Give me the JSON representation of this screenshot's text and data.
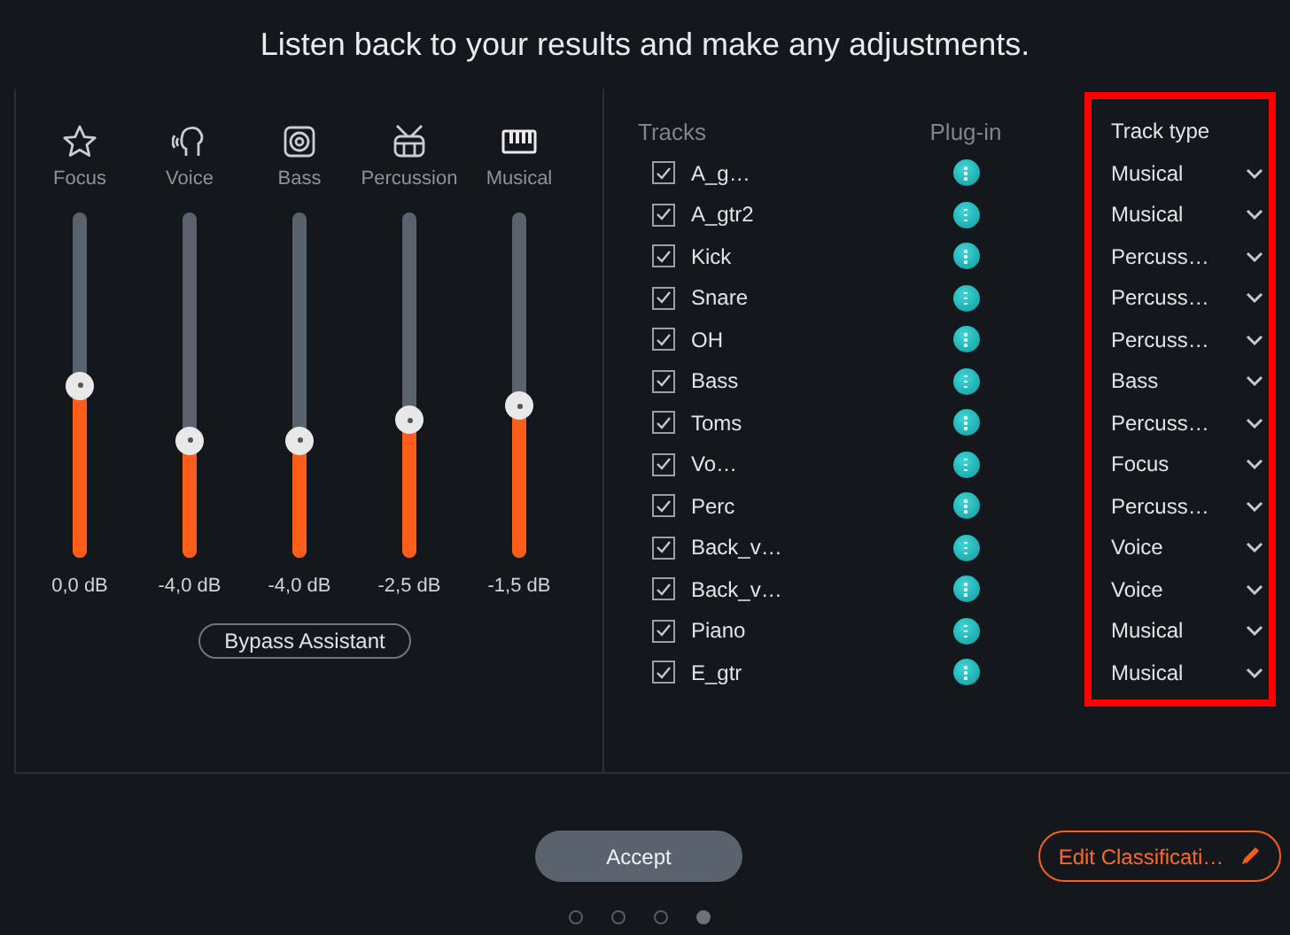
{
  "title": "Listen back to your results and make any adjustments.",
  "channels": [
    {
      "kind": "star",
      "label": "Focus",
      "level": 0.5,
      "reading": "0,0 dB"
    },
    {
      "kind": "voice",
      "label": "Voice",
      "level": 0.34,
      "reading": "-4,0 dB"
    },
    {
      "kind": "speaker",
      "label": "Bass",
      "level": 0.34,
      "reading": "-4,0 dB"
    },
    {
      "kind": "drum",
      "label": "Percussion",
      "level": 0.4,
      "reading": "-2,5 dB"
    },
    {
      "kind": "keys",
      "label": "Musical",
      "level": 0.44,
      "reading": "-1,5 dB"
    }
  ],
  "bypass_button": "Bypass Assistant",
  "table": {
    "columns": [
      "Tracks",
      "Plug-in",
      "Track type"
    ],
    "track_type_highlighted": true,
    "rows": [
      {
        "checked": true,
        "name": "A_g…",
        "type": "Musical"
      },
      {
        "checked": true,
        "name": "A_gtr2",
        "type": "Musical"
      },
      {
        "checked": true,
        "name": "Kick",
        "type": "Percuss…"
      },
      {
        "checked": true,
        "name": "Snare",
        "type": "Percuss…"
      },
      {
        "checked": true,
        "name": "OH",
        "type": "Percuss…"
      },
      {
        "checked": true,
        "name": "Bass",
        "type": "Bass"
      },
      {
        "checked": true,
        "name": "Toms",
        "type": "Percuss…"
      },
      {
        "checked": true,
        "name": "Vo…",
        "type": "Focus"
      },
      {
        "checked": true,
        "name": "Perc",
        "type": "Percuss…"
      },
      {
        "checked": true,
        "name": "Back_v…",
        "type": "Voice"
      },
      {
        "checked": true,
        "name": "Back_v…",
        "type": "Voice"
      },
      {
        "checked": true,
        "name": "Piano",
        "type": "Musical"
      },
      {
        "checked": true,
        "name": "E_gtr",
        "type": "Musical"
      }
    ]
  },
  "accept_button": "Accept",
  "edit_button": "Edit Classificati…",
  "pages": [
    {
      "selected": false
    },
    {
      "selected": false
    },
    {
      "selected": false
    },
    {
      "selected": true
    }
  ]
}
